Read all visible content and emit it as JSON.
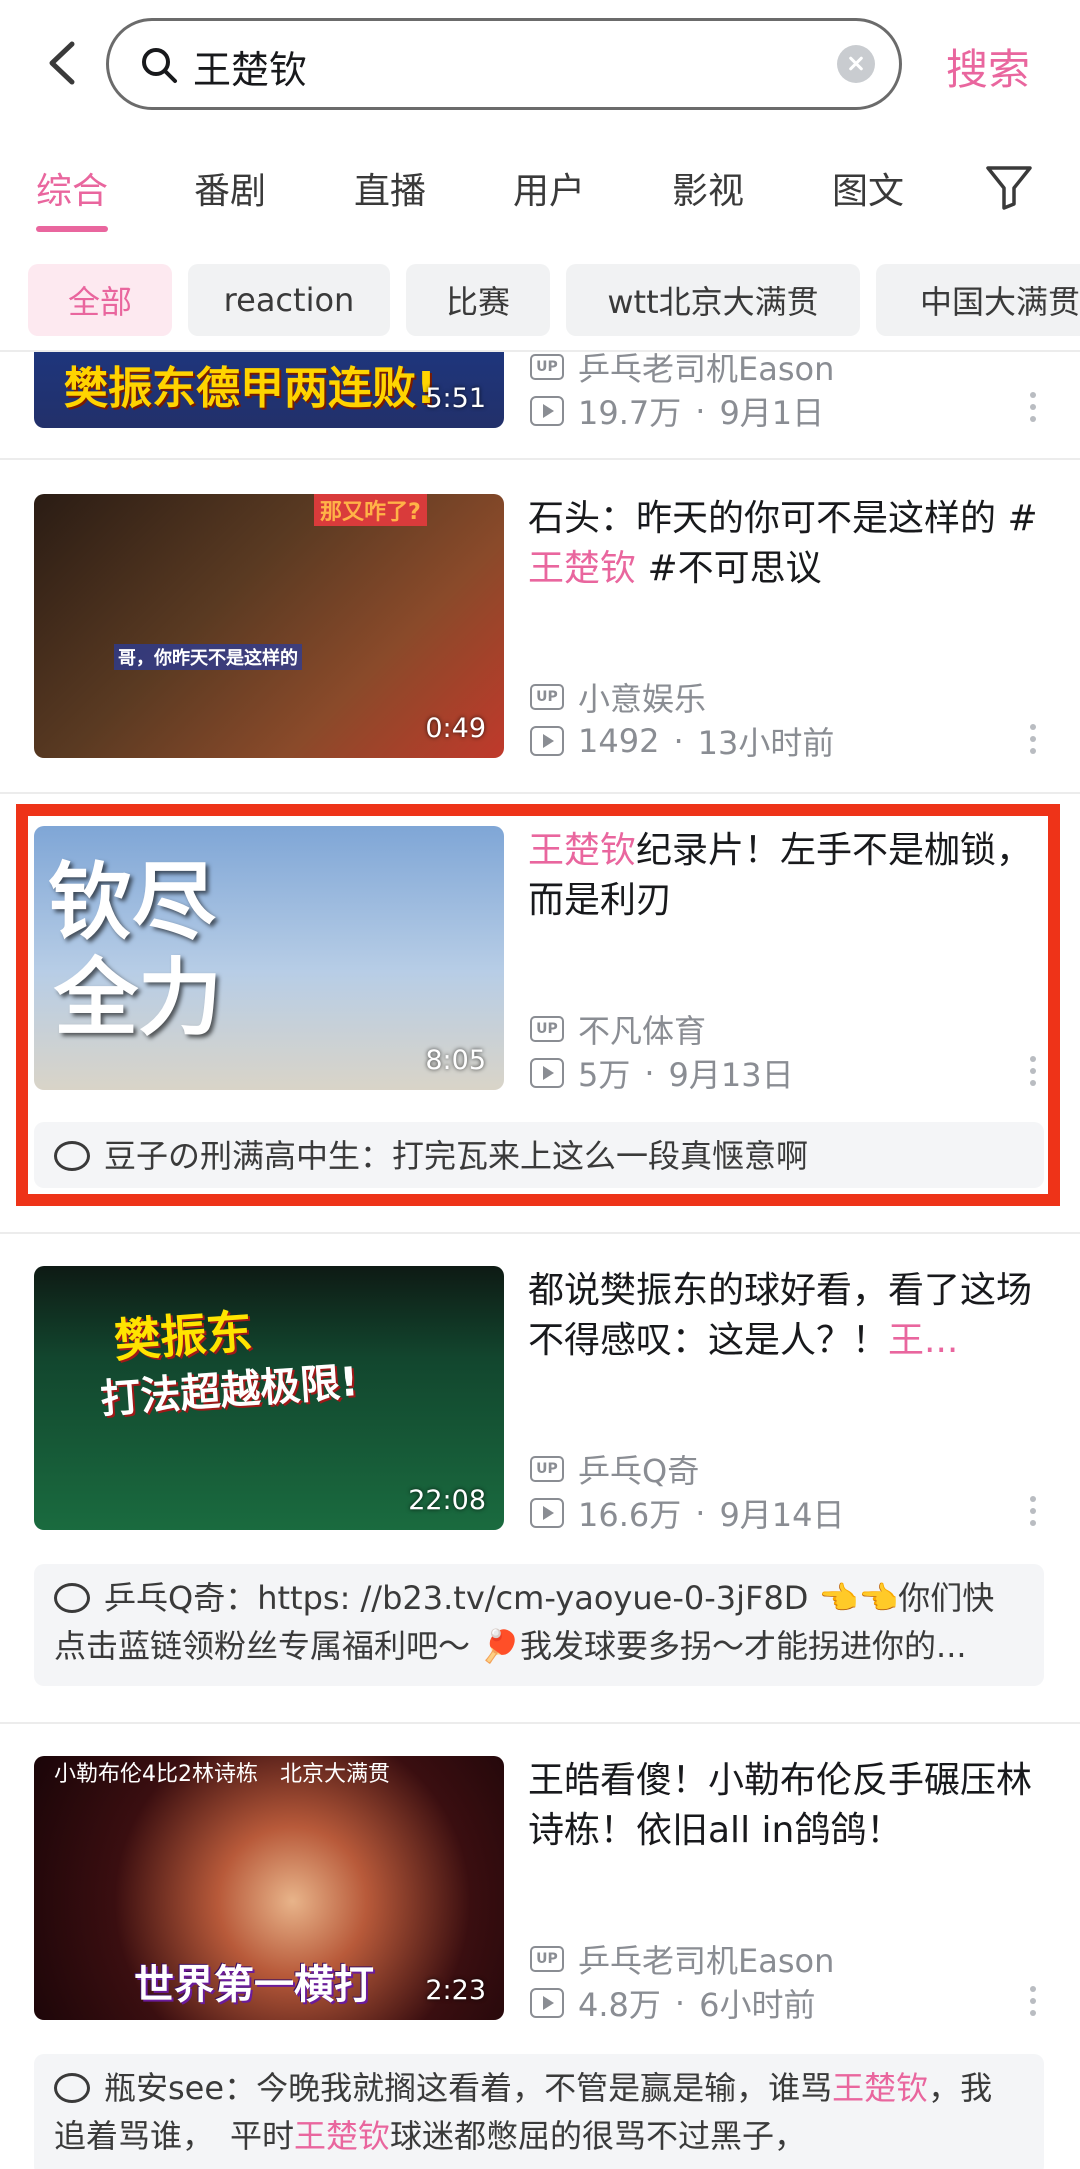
{
  "search": {
    "query": "王楚钦",
    "button": "搜索"
  },
  "tabs": [
    "综合",
    "番剧",
    "直播",
    "用户",
    "影视",
    "图文"
  ],
  "chips": [
    "全部",
    "reaction",
    "比赛",
    "wtt北京大满贯",
    "中国大满贯"
  ],
  "videos": [
    {
      "thumb_text": "樊振东德甲两连败!",
      "duration": "5:51",
      "uploader": "乒乓老司机Eason",
      "views": "19.7万",
      "date": "9月1日"
    },
    {
      "title_pre": "石头：昨天的你可不是这样的 #",
      "title_hl": "王楚钦",
      "title_post": " #不可思议",
      "thumb_top_text": "那又咋了?",
      "thumb_sub_text": "哥，你昨天不是这样的",
      "duration": "0:49",
      "uploader": "小意娱乐",
      "views": "1492",
      "date": "13小时前"
    },
    {
      "title_hl": "王楚钦",
      "title_post": "纪录片！左手不是枷锁，而是利刃",
      "thumb_line1": "钦尽",
      "thumb_line2": "全力",
      "duration": "8:05",
      "uploader": "不凡体育",
      "views": "5万",
      "date": "9月13日",
      "comment_user": "豆子の刑满高中生",
      "comment_text": "：打完瓦来上这么一段真惬意啊"
    },
    {
      "title_pre": "都说樊振东的球好看，看了这场不得感叹：这是人？！",
      "title_hl": "王...",
      "thumb_line1": "樊振东",
      "thumb_line2": "打法超越极限!",
      "duration": "22:08",
      "uploader": "乒乓Q奇",
      "views": "16.6万",
      "date": "9月14日",
      "comment_user": "乒乓Q奇",
      "comment_text": "：https: //b23.tv/cm-yaoyue-0-3jF8D 👈👈你们快点击蓝链领粉丝专属福利吧～ 🏓我发球要多拐～才能拐进你的..."
    },
    {
      "title_pre": "王皓看傻！小勒布伦反手碾压林诗栋！依旧all in鸽鸽！",
      "thumb_top_text": "小勒布伦4比2林诗栋　北京大满贯",
      "thumb_bottom_text": "世界第一横打",
      "duration": "2:23",
      "uploader": "乒乓老司机Eason",
      "views": "4.8万",
      "date": "6小时前",
      "comment_user": "瓶安see",
      "comment_part1": "：今晚我就搁这看着，不管是赢是输，谁骂",
      "comment_hl1": "王楚钦",
      "comment_part2": "，我追着骂谁，　平时",
      "comment_hl2": "王楚钦",
      "comment_part3": "球迷都憋屈的很骂不过黑子，"
    }
  ],
  "colors": {
    "accent": "#e9669e",
    "highlight_border": "#ee3318"
  }
}
